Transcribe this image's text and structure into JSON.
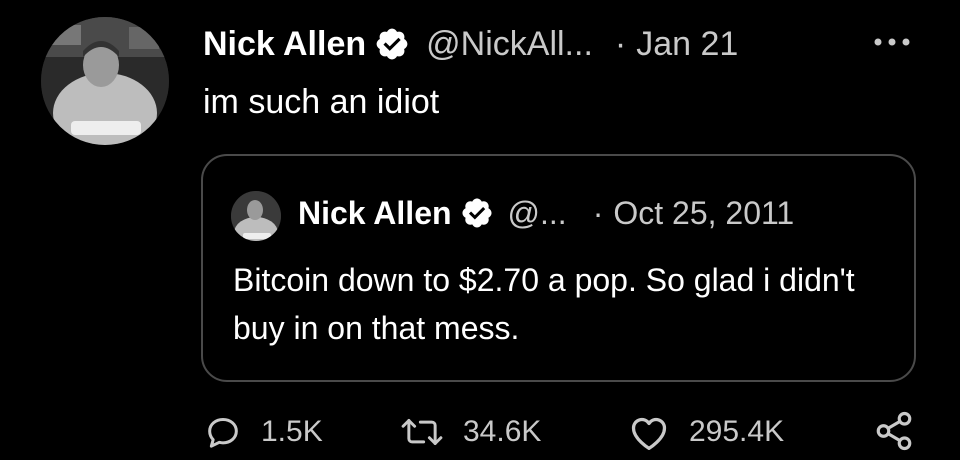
{
  "tweet": {
    "author_name": "Nick Allen",
    "handle": "@NickAll...",
    "separator": "·",
    "date": "Jan 21",
    "text": "im such an idiot",
    "verified_icon": "verified-badge-icon",
    "more_icon": "more-options-icon"
  },
  "quoted_tweet": {
    "author_name": "Nick Allen",
    "handle": "@...",
    "separator": "·",
    "date": "Oct 25, 2011",
    "text": "Bitcoin down to $2.70 a pop. So glad i didn't buy in on that mess."
  },
  "actions": {
    "reply": {
      "icon": "reply-icon",
      "count": "1.5K"
    },
    "retweet": {
      "icon": "retweet-icon",
      "count": "34.6K"
    },
    "like": {
      "icon": "heart-icon",
      "count": "295.4K"
    },
    "share": {
      "icon": "share-icon"
    }
  },
  "colors": {
    "background": "#000000",
    "text_primary": "#ffffff",
    "text_secondary": "#c9c9c9",
    "border": "#4a4a4a"
  }
}
